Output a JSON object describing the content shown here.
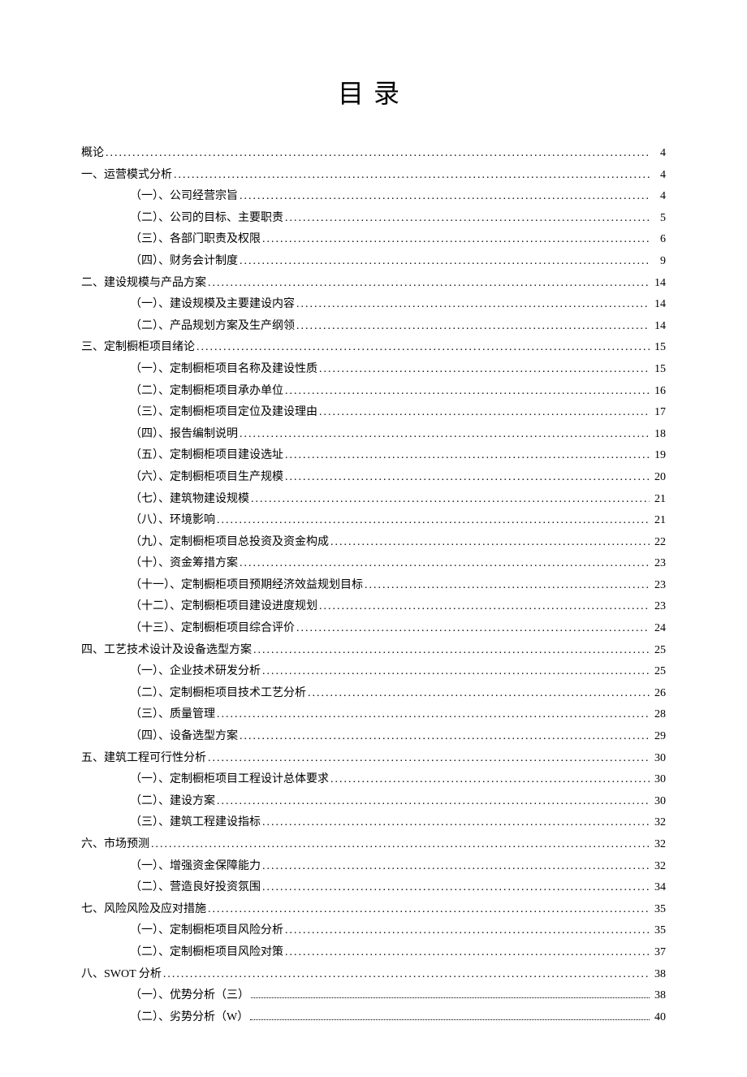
{
  "title": "目录",
  "toc": [
    {
      "level": 0,
      "label": "概论",
      "page": "4",
      "dotstyle": "normal"
    },
    {
      "level": 0,
      "label": "一、运营模式分析",
      "page": "4",
      "dotstyle": "normal"
    },
    {
      "level": 1,
      "label": "（一）、公司经营宗旨",
      "page": "4",
      "dotstyle": "normal"
    },
    {
      "level": 1,
      "label": "（二）、公司的目标、主要职责",
      "page": "5",
      "dotstyle": "normal"
    },
    {
      "level": 1,
      "label": "（三）、各部门职责及权限",
      "page": "6",
      "dotstyle": "normal"
    },
    {
      "level": 1,
      "label": "（四）、财务会计制度",
      "page": "9",
      "dotstyle": "normal"
    },
    {
      "level": 0,
      "label": "二、建设规模与产品方案",
      "page": "14",
      "dotstyle": "normal"
    },
    {
      "level": 1,
      "label": "（一）、建设规模及主要建设内容",
      "page": "14",
      "dotstyle": "normal"
    },
    {
      "level": 1,
      "label": "（二）、产品规划方案及生产纲领",
      "page": "14",
      "dotstyle": "normal"
    },
    {
      "level": 0,
      "label": "三、定制橱柜项目绪论",
      "page": "15",
      "dotstyle": "normal"
    },
    {
      "level": 1,
      "label": "（一）、定制橱柜项目名称及建设性质",
      "page": "15",
      "dotstyle": "normal"
    },
    {
      "level": 1,
      "label": "（二）、定制橱柜项目承办单位",
      "page": "16",
      "dotstyle": "normal"
    },
    {
      "level": 1,
      "label": "（三）、定制橱柜项目定位及建设理由",
      "page": "17",
      "dotstyle": "normal"
    },
    {
      "level": 1,
      "label": "（四）、报告编制说明",
      "page": "18",
      "dotstyle": "normal"
    },
    {
      "level": 1,
      "label": "（五）、定制橱柜项目建设选址",
      "page": "19",
      "dotstyle": "normal"
    },
    {
      "level": 1,
      "label": "（六）、定制橱柜项目生产规模",
      "page": "20",
      "dotstyle": "normal"
    },
    {
      "level": 1,
      "label": "（七）、建筑物建设规模",
      "page": "21",
      "dotstyle": "normal"
    },
    {
      "level": 1,
      "label": "（八）、环境影响",
      "page": "21",
      "dotstyle": "normal"
    },
    {
      "level": 1,
      "label": "（九）、定制橱柜项目总投资及资金构成",
      "page": "22",
      "dotstyle": "normal"
    },
    {
      "level": 1,
      "label": "（十）、资金筹措方案",
      "page": "23",
      "dotstyle": "normal"
    },
    {
      "level": 1,
      "label": "（十一）、定制橱柜项目预期经济效益规划目标",
      "page": "23",
      "dotstyle": "normal"
    },
    {
      "level": 1,
      "label": "（十二）、定制橱柜项目建设进度规划",
      "page": "23",
      "dotstyle": "normal"
    },
    {
      "level": 1,
      "label": "（十三）、定制橱柜项目综合评价",
      "page": "24",
      "dotstyle": "normal"
    },
    {
      "level": 0,
      "label": "四、工艺技术设计及设备选型方案",
      "page": "25",
      "dotstyle": "normal"
    },
    {
      "level": 1,
      "label": "（一）、企业技术研发分析",
      "page": "25",
      "dotstyle": "normal"
    },
    {
      "level": 1,
      "label": "（二）、定制橱柜项目技术工艺分析",
      "page": "26",
      "dotstyle": "normal"
    },
    {
      "level": 1,
      "label": "（三）、质量管理",
      "page": "28",
      "dotstyle": "normal"
    },
    {
      "level": 1,
      "label": "（四）、设备选型方案",
      "page": "29",
      "dotstyle": "normal"
    },
    {
      "level": 0,
      "label": "五、建筑工程可行性分析",
      "page": "30",
      "dotstyle": "normal"
    },
    {
      "level": 1,
      "label": "（一）、定制橱柜项目工程设计总体要求",
      "page": "30",
      "dotstyle": "normal"
    },
    {
      "level": 1,
      "label": "（二）、建设方案",
      "page": "30",
      "dotstyle": "normal"
    },
    {
      "level": 1,
      "label": "（三）、建筑工程建设指标",
      "page": "32",
      "dotstyle": "normal"
    },
    {
      "level": 0,
      "label": "六、市场预测",
      "page": "32",
      "dotstyle": "normal"
    },
    {
      "level": 1,
      "label": "（一）、增强资金保障能力",
      "page": "32",
      "dotstyle": "normal"
    },
    {
      "level": 1,
      "label": "（二）、营造良好投资氛围",
      "page": "34",
      "dotstyle": "normal"
    },
    {
      "level": 0,
      "label": "七、风险风险及应对措施",
      "page": "35",
      "dotstyle": "normal"
    },
    {
      "level": 1,
      "label": "（一）、定制橱柜项目风险分析",
      "page": "35",
      "dotstyle": "normal"
    },
    {
      "level": 1,
      "label": "（二）、定制橱柜项目风险对策",
      "page": "37",
      "dotstyle": "normal"
    },
    {
      "level": 0,
      "label": "八、SWOT 分析",
      "page": "38",
      "dotstyle": "normal"
    },
    {
      "level": 1,
      "label": "（一）、优势分析（三）",
      "page": "38",
      "dotstyle": "fine"
    },
    {
      "level": 1,
      "label": "（二）、劣势分析（W）",
      "page": "40",
      "dotstyle": "fine"
    }
  ]
}
